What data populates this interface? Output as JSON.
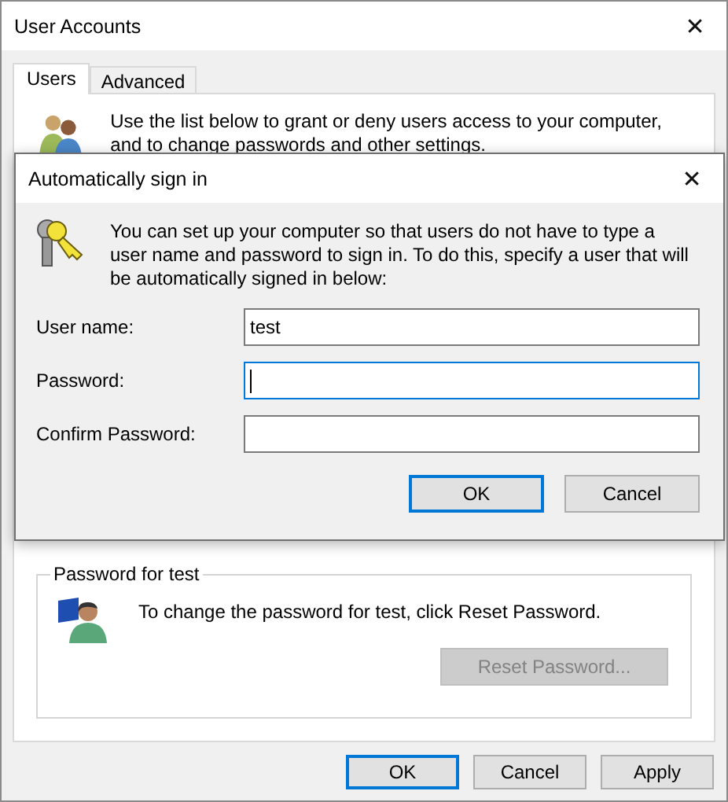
{
  "window": {
    "title": "User Accounts",
    "close": "✕"
  },
  "tabs": [
    {
      "label": "Users",
      "selected": true
    },
    {
      "label": "Advanced",
      "selected": false
    }
  ],
  "users_tab": {
    "intro": "Use the list below to grant or deny users access to your computer, and to change passwords and other settings.",
    "password_group": {
      "title": "Password for test",
      "text": "To change the password for test, click Reset Password.",
      "button": {
        "label": "Reset Password...",
        "disabled": true
      }
    }
  },
  "buttons": [
    {
      "label": "OK",
      "default": true
    },
    {
      "label": "Cancel",
      "default": false
    },
    {
      "label": "Apply",
      "default": false
    }
  ],
  "dialog": {
    "title": "Automatically sign in",
    "close": "✕",
    "description": "You can set up your computer so that users do not have to type a user name and password to sign in. To do this, specify a user that will be automatically signed in below:",
    "fields": [
      {
        "label": "User name:",
        "value": "test",
        "focused": false
      },
      {
        "label": "Password:",
        "focused": true
      },
      {
        "label": "Confirm Password:",
        "focused": false
      }
    ],
    "buttons": [
      {
        "label": "OK",
        "default": true
      },
      {
        "label": "Cancel",
        "default": false
      }
    ]
  }
}
